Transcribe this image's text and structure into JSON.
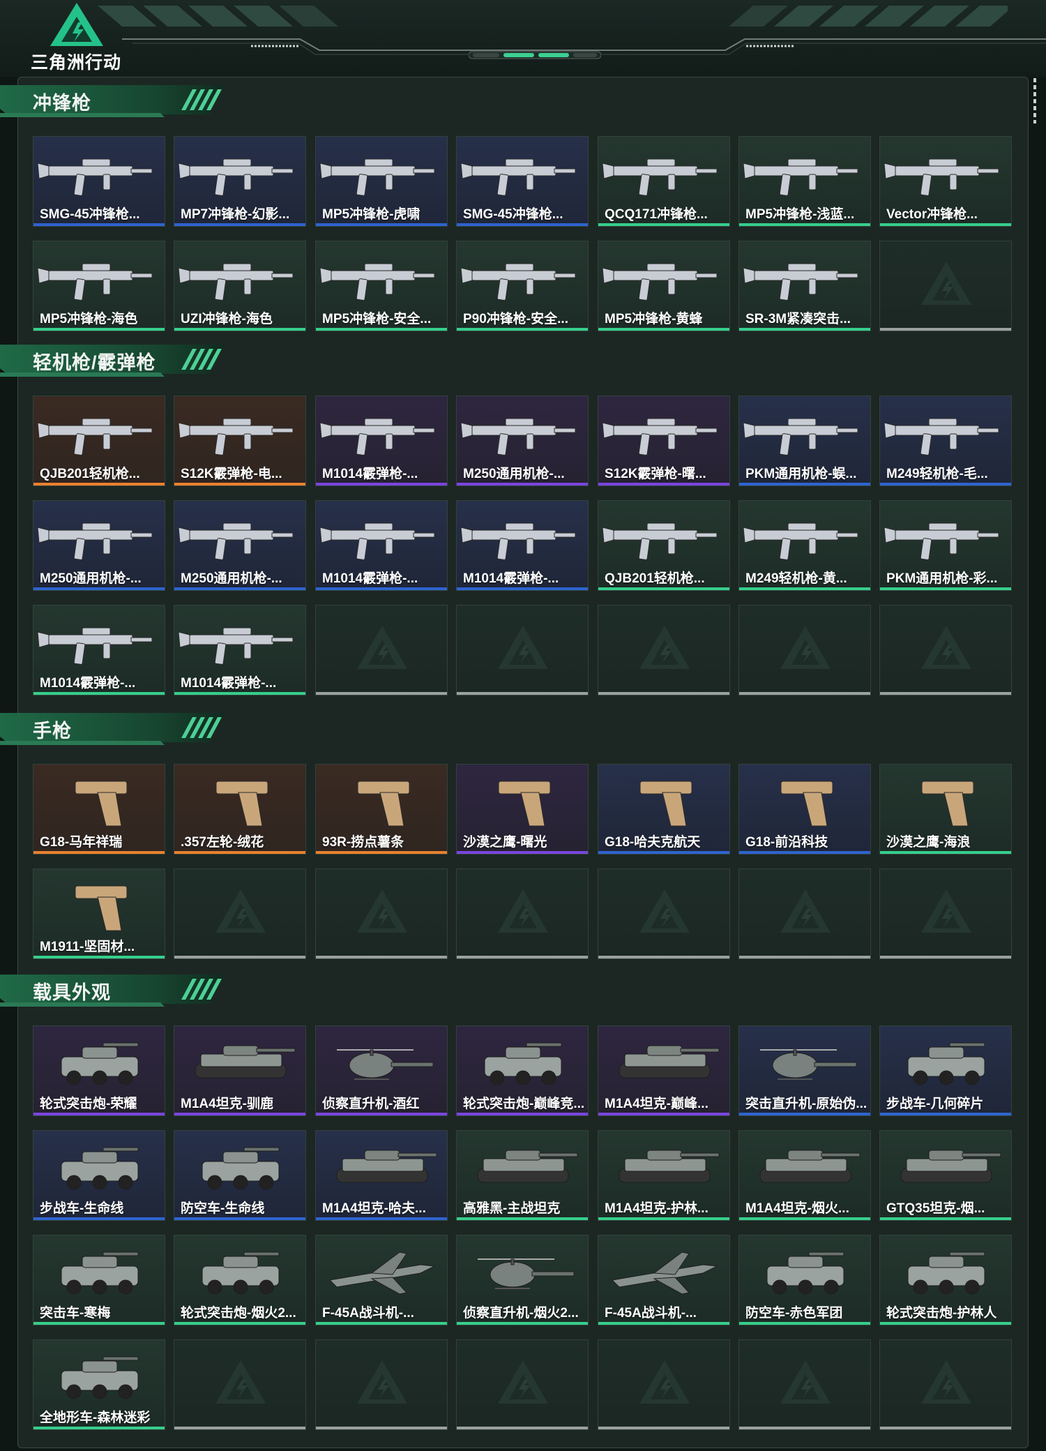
{
  "app": {
    "logo_text": "三角洲行动"
  },
  "colors": {
    "gold": "#e9812e",
    "purple": "#7a45e0",
    "blue": "#2e64d0",
    "green": "#36cf8c",
    "gray": "#9aa19e"
  },
  "sections": [
    {
      "title": "冲锋枪",
      "items": [
        {
          "name": "SMG-45冲锋枪...",
          "tier": "blue",
          "art": "gun"
        },
        {
          "name": "MP7冲锋枪-幻影...",
          "tier": "blue",
          "art": "gun"
        },
        {
          "name": "MP5冲锋枪-虎啸",
          "tier": "blue",
          "art": "gun"
        },
        {
          "name": "SMG-45冲锋枪...",
          "tier": "blue",
          "art": "gun"
        },
        {
          "name": "QCQ171冲锋枪...",
          "tier": "green",
          "art": "gun"
        },
        {
          "name": "MP5冲锋枪-浅蓝...",
          "tier": "green",
          "art": "gun"
        },
        {
          "name": "Vector冲锋枪...",
          "tier": "green",
          "art": "gun"
        },
        {
          "name": "MP5冲锋枪-海色",
          "tier": "green",
          "art": "gun"
        },
        {
          "name": "UZI冲锋枪-海色",
          "tier": "green",
          "art": "gun"
        },
        {
          "name": "MP5冲锋枪-安全...",
          "tier": "green",
          "art": "gun"
        },
        {
          "name": "P90冲锋枪-安全...",
          "tier": "green",
          "art": "gun"
        },
        {
          "name": "MP5冲锋枪-黄蜂",
          "tier": "green",
          "art": "gun"
        },
        {
          "name": "SR-3M紧凑突击...",
          "tier": "green",
          "art": "gun"
        },
        {
          "name": "",
          "tier": "empty"
        }
      ]
    },
    {
      "title": "轻机枪/霰弹枪",
      "items": [
        {
          "name": "QJB201轻机枪...",
          "tier": "gold",
          "art": "gun"
        },
        {
          "name": "S12K霰弹枪-电...",
          "tier": "gold",
          "art": "gun"
        },
        {
          "name": "M1014霰弹枪-...",
          "tier": "purple",
          "art": "gun"
        },
        {
          "name": "M250通用机枪-...",
          "tier": "purple",
          "art": "gun"
        },
        {
          "name": "S12K霰弹枪-曙...",
          "tier": "purple",
          "art": "gun"
        },
        {
          "name": "PKM通用机枪-蜈...",
          "tier": "blue",
          "art": "gun"
        },
        {
          "name": "M249轻机枪-毛...",
          "tier": "blue",
          "art": "gun"
        },
        {
          "name": "M250通用机枪-...",
          "tier": "blue",
          "art": "gun"
        },
        {
          "name": "M250通用机枪-...",
          "tier": "blue",
          "art": "gun"
        },
        {
          "name": "M1014霰弹枪-...",
          "tier": "blue",
          "art": "gun"
        },
        {
          "name": "M1014霰弹枪-...",
          "tier": "blue",
          "art": "gun"
        },
        {
          "name": "QJB201轻机枪...",
          "tier": "green",
          "art": "gun"
        },
        {
          "name": "M249轻机枪-黄...",
          "tier": "green",
          "art": "gun"
        },
        {
          "name": "PKM通用机枪-彩...",
          "tier": "green",
          "art": "gun"
        },
        {
          "name": "M1014霰弹枪-...",
          "tier": "green",
          "art": "gun"
        },
        {
          "name": "M1014霰弹枪-...",
          "tier": "green",
          "art": "gun"
        },
        {
          "name": "",
          "tier": "empty"
        },
        {
          "name": "",
          "tier": "empty"
        },
        {
          "name": "",
          "tier": "empty"
        },
        {
          "name": "",
          "tier": "empty"
        },
        {
          "name": "",
          "tier": "empty"
        }
      ]
    },
    {
      "title": "手枪",
      "items": [
        {
          "name": "G18-马年祥瑞",
          "tier": "gold",
          "art": "pistol"
        },
        {
          "name": ".357左轮-绒花",
          "tier": "gold",
          "art": "pistol"
        },
        {
          "name": "93R-捞点薯条",
          "tier": "gold",
          "art": "pistol"
        },
        {
          "name": "沙漠之鹰-曙光",
          "tier": "purple",
          "art": "pistol"
        },
        {
          "name": "G18-哈夫克航天",
          "tier": "blue",
          "art": "pistol"
        },
        {
          "name": "G18-前沿科技",
          "tier": "blue",
          "art": "pistol"
        },
        {
          "name": "沙漠之鹰-海浪",
          "tier": "green",
          "art": "pistol"
        },
        {
          "name": "M1911-坚固材...",
          "tier": "green",
          "art": "pistol"
        },
        {
          "name": "",
          "tier": "empty"
        },
        {
          "name": "",
          "tier": "empty"
        },
        {
          "name": "",
          "tier": "empty"
        },
        {
          "name": "",
          "tier": "empty"
        },
        {
          "name": "",
          "tier": "empty"
        },
        {
          "name": "",
          "tier": "empty"
        }
      ]
    },
    {
      "title": "载具外观",
      "items": [
        {
          "name": "轮式突击炮-荣耀",
          "tier": "purple",
          "art": "vehicle"
        },
        {
          "name": "M1A4坦克-驯鹿",
          "tier": "purple",
          "art": "tank"
        },
        {
          "name": "侦察直升机-酒红",
          "tier": "purple",
          "art": "heli"
        },
        {
          "name": "轮式突击炮-巅峰竞...",
          "tier": "purple",
          "art": "vehicle"
        },
        {
          "name": "M1A4坦克-巅峰...",
          "tier": "purple",
          "art": "tank"
        },
        {
          "name": "突击直升机-原始伪...",
          "tier": "blue",
          "art": "heli"
        },
        {
          "name": "步战车-几何碎片",
          "tier": "blue",
          "art": "vehicle"
        },
        {
          "name": "步战车-生命线",
          "tier": "blue",
          "art": "vehicle"
        },
        {
          "name": "防空车-生命线",
          "tier": "blue",
          "art": "vehicle"
        },
        {
          "name": "M1A4坦克-哈夫...",
          "tier": "blue",
          "art": "tank"
        },
        {
          "name": "高雅黑-主战坦克",
          "tier": "green",
          "art": "tank"
        },
        {
          "name": "M1A4坦克-护林...",
          "tier": "green",
          "art": "tank"
        },
        {
          "name": "M1A4坦克-烟火...",
          "tier": "green",
          "art": "tank"
        },
        {
          "name": "GTQ35坦克-烟...",
          "tier": "green",
          "art": "tank"
        },
        {
          "name": "突击车-寒梅",
          "tier": "green",
          "art": "vehicle"
        },
        {
          "name": "轮式突击炮-烟火2...",
          "tier": "green",
          "art": "vehicle"
        },
        {
          "name": "F-45A战斗机-...",
          "tier": "green",
          "art": "jet"
        },
        {
          "name": "侦察直升机-烟火2...",
          "tier": "green",
          "art": "heli"
        },
        {
          "name": "F-45A战斗机-...",
          "tier": "green",
          "art": "jet"
        },
        {
          "name": "防空车-赤色军团",
          "tier": "green",
          "art": "vehicle"
        },
        {
          "name": "轮式突击炮-护林人",
          "tier": "green",
          "art": "vehicle"
        },
        {
          "name": "全地形车-森林迷彩",
          "tier": "green",
          "art": "vehicle"
        },
        {
          "name": "",
          "tier": "empty"
        },
        {
          "name": "",
          "tier": "empty"
        },
        {
          "name": "",
          "tier": "empty"
        },
        {
          "name": "",
          "tier": "empty"
        },
        {
          "name": "",
          "tier": "empty"
        },
        {
          "name": "",
          "tier": "empty"
        }
      ]
    }
  ]
}
